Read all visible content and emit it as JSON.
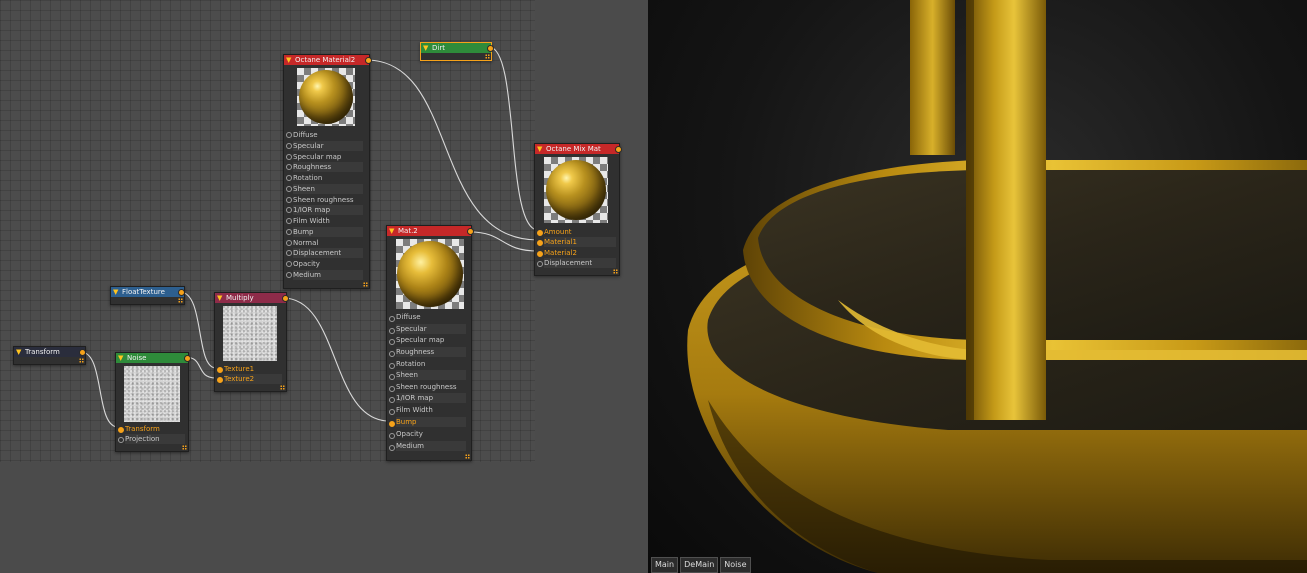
{
  "nodes": {
    "octane_material2": {
      "title": "Octane Material2",
      "header_color": "#c62828",
      "inputs": [
        "Diffuse",
        "Specular",
        "Specular map",
        "Roughness",
        "Rotation",
        "Sheen",
        "Sheen roughness",
        "1/IOR map",
        "Film Width",
        "Bump",
        "Normal",
        "Displacement",
        "Opacity",
        "Medium"
      ]
    },
    "dirt": {
      "title": "Dirt",
      "header_color": "#2e8b3a"
    },
    "octane_mix_mat": {
      "title": "Octane Mix Mat",
      "header_color": "#c62828",
      "inputs": [
        "Amount",
        "Material1",
        "Material2",
        "Displacement"
      ]
    },
    "mat2": {
      "title": "Mat.2",
      "header_color": "#c62828",
      "inputs": [
        "Diffuse",
        "Specular",
        "Specular map",
        "Roughness",
        "Rotation",
        "Sheen",
        "Sheen roughness",
        "1/IOR map",
        "Film Width",
        "Bump",
        "Opacity",
        "Medium"
      ]
    },
    "float_texture": {
      "title": "FloatTexture",
      "header_color": "#2d5f8f"
    },
    "multiply": {
      "title": "Multiply",
      "header_color": "#8e2b49",
      "inputs": [
        "Texture1",
        "Texture2"
      ]
    },
    "transform": {
      "title": "Transform",
      "header_color": "#2a2d3c"
    },
    "noise": {
      "title": "Noise",
      "header_color": "#2e8b3a",
      "inputs": [
        "Transform",
        "Projection"
      ]
    }
  },
  "viewport": {
    "tabs": [
      "Main",
      "DeMain",
      "Noise"
    ]
  },
  "colors": {
    "port_active": "#f6a21a",
    "wire": "#d9d9d9",
    "editor_bg": "#4b4b4b"
  },
  "icons": [
    "collapse-triangle-icon",
    "output-port-icon",
    "input-port-icon",
    "resize-grip-icon"
  ]
}
